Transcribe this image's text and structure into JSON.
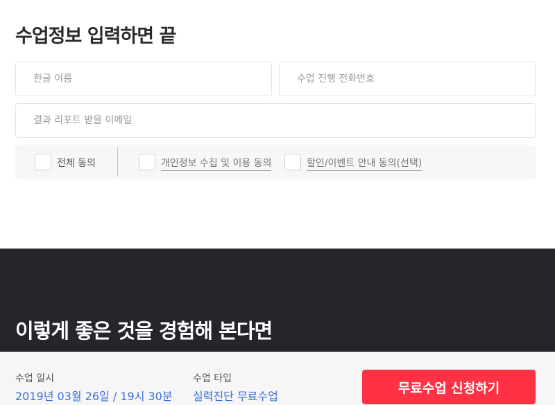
{
  "form": {
    "title": "수업정보 입력하면 끝",
    "name_placeholder": "한글 이름",
    "phone_placeholder": "수업 진행 전화번호",
    "email_placeholder": "결과 리포트 받을 이메일"
  },
  "agreements": {
    "all_label": "전체 동의",
    "privacy_label": "개인정보 수집 및 이용 동의",
    "marketing_label": "할인/이벤트 안내 동의(선택)"
  },
  "promo": {
    "title": "이렇게 좋은 것을 경험해 본다면"
  },
  "class_info": {
    "date_label": "수업 일시",
    "date_value": "2019년 03월 26일 / 19시 30분",
    "type_label": "수업 타입",
    "type_value": "실력진단 무료수업",
    "apply_label": "무료수업 신청하기"
  },
  "colors": {
    "accent_red": "#ff3145",
    "link_blue": "#3a6fd8",
    "dark_bg": "#25252c"
  }
}
